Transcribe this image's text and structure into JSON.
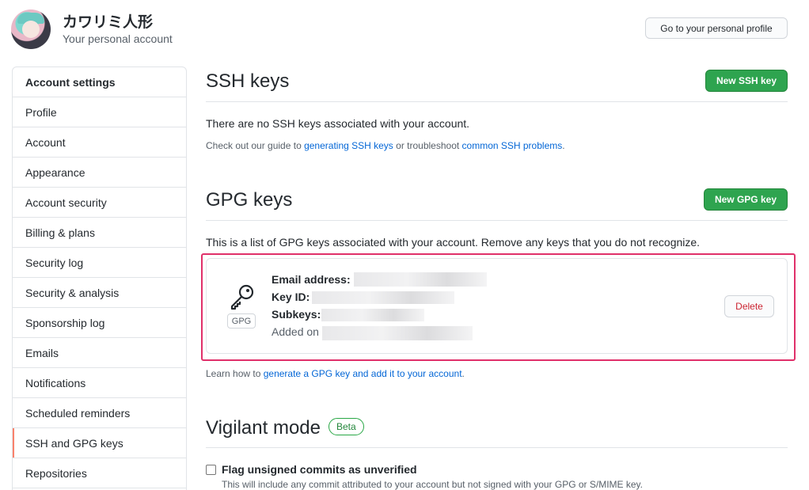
{
  "header": {
    "user_name": "カワリミ人形",
    "subtitle": "Your personal account",
    "profile_button": "Go to your personal profile"
  },
  "sidebar": {
    "items": [
      {
        "label": "Account settings"
      },
      {
        "label": "Profile"
      },
      {
        "label": "Account"
      },
      {
        "label": "Appearance"
      },
      {
        "label": "Account security"
      },
      {
        "label": "Billing & plans"
      },
      {
        "label": "Security log"
      },
      {
        "label": "Security & analysis"
      },
      {
        "label": "Sponsorship log"
      },
      {
        "label": "Emails"
      },
      {
        "label": "Notifications"
      },
      {
        "label": "Scheduled reminders"
      },
      {
        "label": "SSH and GPG keys"
      },
      {
        "label": "Repositories"
      }
    ],
    "active": "SSH and GPG keys"
  },
  "ssh": {
    "title": "SSH keys",
    "new_button": "New SSH key",
    "empty_text": "There are no SSH keys associated with your account.",
    "guide_prefix": "Check out our guide to ",
    "guide_link": "generating SSH keys",
    "guide_middle": " or troubleshoot ",
    "problems_link": "common SSH problems",
    "guide_suffix": "."
  },
  "gpg": {
    "title": "GPG keys",
    "new_button": "New GPG key",
    "description": "This is a list of GPG keys associated with your account. Remove any keys that you do not recognize.",
    "key": {
      "badge": "GPG",
      "email_label": "Email address:",
      "key_id_label": "Key ID:",
      "subkeys_label": "Subkeys:",
      "added_label": "Added on",
      "delete_button": "Delete"
    },
    "learn_prefix": "Learn how to ",
    "learn_link": "generate a GPG key and add it to your account",
    "learn_suffix": "."
  },
  "vigilant": {
    "title": "Vigilant mode",
    "badge": "Beta",
    "checkbox_label": "Flag unsigned commits as unverified",
    "checkbox_desc": "This will include any commit attributed to your account but not signed with your GPG or S/MIME key.",
    "checked": false
  },
  "colors": {
    "green": "#2ea44f",
    "link": "#0366d6",
    "highlight": "#e0306a",
    "danger": "#cb2431",
    "active_marker": "#f9826c"
  }
}
